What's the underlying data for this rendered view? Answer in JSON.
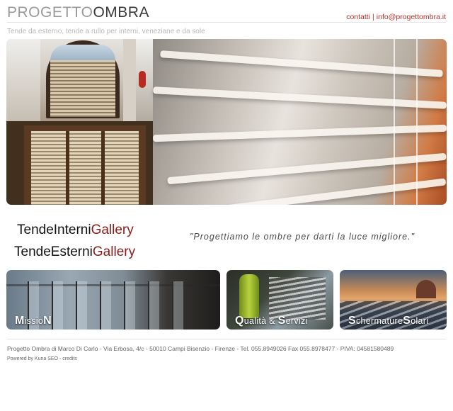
{
  "header": {
    "logo_light": "PROGETTO",
    "logo_strong": "OMBRA",
    "contact_link": "contatti",
    "contact_separator": "|",
    "email_link": "info@progettombra.it",
    "tagline": "Tende da esterno, tende a rullo per interni, veneziane e da sole"
  },
  "galleries": {
    "interni_prefix": "TendeInterni",
    "interni_accent": "Gallery",
    "esterni_prefix": "TendeEsterni",
    "esterni_accent": "Gallery"
  },
  "quote": "\"Progettiamo le ombre per darti la luce migliore.\"",
  "tiles": [
    {
      "parts": [
        "M",
        "issio",
        "N"
      ]
    },
    {
      "parts": [
        "Q",
        "ualità & ",
        "S",
        "ervizi"
      ]
    },
    {
      "parts": [
        "S",
        "chermature",
        "S",
        "olari"
      ]
    }
  ],
  "footer": {
    "company_line": "Progetto Ombra di Marco Di Carlo - Via Erbosa, 4/c - 50010 Campi Bisenzio - Firenze - Tel. 055.8949026 Fax 055.8978477 - PIVA: 04581580489",
    "powered_prefix": "Powered by",
    "powered_link": "Kuna SEO",
    "powered_separator": "-",
    "credits_link": "credits"
  },
  "colors": {
    "accent_red": "#b9302a",
    "gallery_red": "#8b1a1a"
  }
}
